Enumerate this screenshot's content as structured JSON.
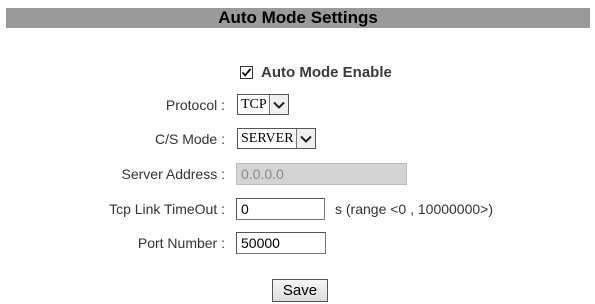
{
  "header": {
    "title": "Auto Mode Settings"
  },
  "auto_mode": {
    "enable_label": "Auto Mode Enable",
    "enabled": true
  },
  "protocol": {
    "label": "Protocol :",
    "value": "TCP"
  },
  "cs_mode": {
    "label": "C/S Mode :",
    "value": "SERVER"
  },
  "server_address": {
    "label": "Server Address :",
    "value": "0.0.0.0"
  },
  "tcp_timeout": {
    "label": "Tcp Link TimeOut :",
    "value": "0",
    "hint": "s (range <0 , 10000000>)"
  },
  "port_number": {
    "label": "Port Number :",
    "value": "50000"
  },
  "actions": {
    "save_label": "Save"
  },
  "colors": {
    "header_bg": "#9a9a9a",
    "disabled_bg": "#d4d4d4"
  },
  "icons": {
    "checkbox": "checkmark-icon",
    "dropdown": "chevron-down-icon"
  }
}
